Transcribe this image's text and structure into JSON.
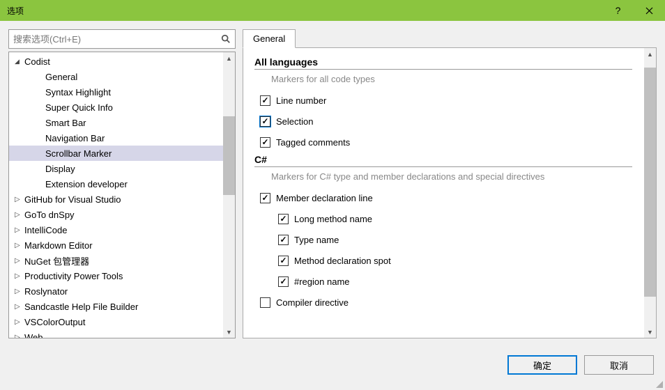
{
  "window": {
    "title": "选项"
  },
  "search": {
    "placeholder": "搜索选项(Ctrl+E)"
  },
  "tree": {
    "items": [
      {
        "label": "Codist",
        "depth": 1,
        "expanded": true
      },
      {
        "label": "General",
        "depth": 2,
        "expanded": null
      },
      {
        "label": "Syntax Highlight",
        "depth": 2,
        "expanded": null
      },
      {
        "label": "Super Quick Info",
        "depth": 2,
        "expanded": null
      },
      {
        "label": "Smart Bar",
        "depth": 2,
        "expanded": null
      },
      {
        "label": "Navigation Bar",
        "depth": 2,
        "expanded": null
      },
      {
        "label": "Scrollbar Marker",
        "depth": 2,
        "expanded": null,
        "selected": true
      },
      {
        "label": "Display",
        "depth": 2,
        "expanded": null
      },
      {
        "label": "Extension developer",
        "depth": 2,
        "expanded": null
      },
      {
        "label": "GitHub for Visual Studio",
        "depth": 1,
        "expanded": false
      },
      {
        "label": "GoTo dnSpy",
        "depth": 1,
        "expanded": false
      },
      {
        "label": "IntelliCode",
        "depth": 1,
        "expanded": false
      },
      {
        "label": "Markdown Editor",
        "depth": 1,
        "expanded": false
      },
      {
        "label": "NuGet 包管理器",
        "depth": 1,
        "expanded": false
      },
      {
        "label": "Productivity Power Tools",
        "depth": 1,
        "expanded": false
      },
      {
        "label": "Roslynator",
        "depth": 1,
        "expanded": false
      },
      {
        "label": "Sandcastle Help File Builder",
        "depth": 1,
        "expanded": false
      },
      {
        "label": "VSColorOutput",
        "depth": 1,
        "expanded": false
      },
      {
        "label": "Web",
        "depth": 1,
        "expanded": false
      }
    ]
  },
  "tabs": {
    "active": "General"
  },
  "sections": [
    {
      "title": "All languages",
      "desc": "Markers for all code types",
      "checks": [
        {
          "label": "Line number",
          "checked": true,
          "sub": false
        },
        {
          "label": "Selection",
          "checked": true,
          "sub": false,
          "focused": true
        },
        {
          "label": "Tagged comments",
          "checked": true,
          "sub": false
        }
      ]
    },
    {
      "title": "C#",
      "desc": "Markers for C# type and member declarations and special directives",
      "checks": [
        {
          "label": "Member declaration line",
          "checked": true,
          "sub": false
        },
        {
          "label": "Long method name",
          "checked": true,
          "sub": true
        },
        {
          "label": "Type name",
          "checked": true,
          "sub": true
        },
        {
          "label": "Method declaration spot",
          "checked": true,
          "sub": true
        },
        {
          "label": "#region name",
          "checked": true,
          "sub": true
        },
        {
          "label": "Compiler directive",
          "checked": false,
          "sub": false
        }
      ]
    }
  ],
  "buttons": {
    "ok": "确定",
    "cancel": "取消"
  }
}
